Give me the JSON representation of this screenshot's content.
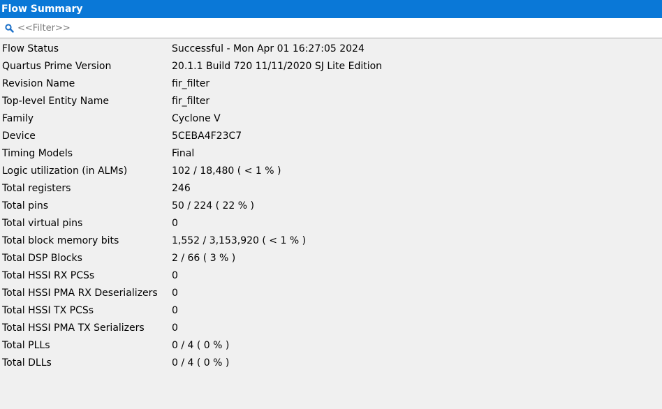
{
  "window": {
    "title": "Flow Summary"
  },
  "filter": {
    "placeholder": "<<Filter>>",
    "value": "",
    "icon": "search-icon"
  },
  "colors": {
    "title_bar": "#0a78d7",
    "search_icon": "#1a6fc8",
    "background": "#f0f0f0"
  },
  "rows": [
    {
      "label": "Flow Status",
      "value": "Successful - Mon Apr 01 16:27:05 2024"
    },
    {
      "label": "Quartus Prime Version",
      "value": "20.1.1 Build 720 11/11/2020 SJ Lite Edition"
    },
    {
      "label": "Revision Name",
      "value": "fir_filter"
    },
    {
      "label": "Top-level Entity Name",
      "value": "fir_filter"
    },
    {
      "label": "Family",
      "value": "Cyclone V"
    },
    {
      "label": "Device",
      "value": "5CEBA4F23C7"
    },
    {
      "label": "Timing Models",
      "value": "Final"
    },
    {
      "label": "Logic utilization (in ALMs)",
      "value": "102 / 18,480 ( < 1 % )"
    },
    {
      "label": "Total registers",
      "value": "246"
    },
    {
      "label": "Total pins",
      "value": "50 / 224 ( 22 % )"
    },
    {
      "label": "Total virtual pins",
      "value": "0"
    },
    {
      "label": "Total block memory bits",
      "value": "1,552 / 3,153,920 ( < 1 % )"
    },
    {
      "label": "Total DSP Blocks",
      "value": "2 / 66 ( 3 % )"
    },
    {
      "label": "Total HSSI RX PCSs",
      "value": "0"
    },
    {
      "label": "Total HSSI PMA RX Deserializers",
      "value": "0"
    },
    {
      "label": "Total HSSI TX PCSs",
      "value": "0"
    },
    {
      "label": "Total HSSI PMA TX Serializers",
      "value": "0"
    },
    {
      "label": "Total PLLs",
      "value": "0 / 4 ( 0 % )"
    },
    {
      "label": "Total DLLs",
      "value": "0 / 4 ( 0 % )"
    }
  ]
}
